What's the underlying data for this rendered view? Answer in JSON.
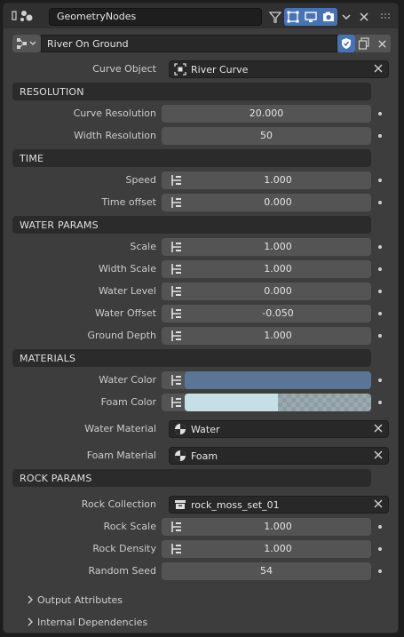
{
  "header": {
    "modifier_name": "GeometryNodes",
    "icons": [
      "wrench-icon",
      "show-in-editmode-icon",
      "show-on-cage-icon",
      "realtime-display-icon",
      "render-icon",
      "chevron-down-icon",
      "close-icon",
      "drag-grip-icon"
    ]
  },
  "node_group": {
    "name": "River On Ground",
    "icons": [
      "node-tree-icon",
      "fake-user-shield-icon",
      "duplicate-icon",
      "close-icon"
    ]
  },
  "curve_object": {
    "label": "Curve Object",
    "value": "River Curve"
  },
  "sections": {
    "resolution": "RESOLUTION",
    "time": "TIME",
    "water_params": "WATER PARAMS",
    "materials": "MATERIALS",
    "rock_params": "ROCK PARAMS"
  },
  "resolution": {
    "curve_resolution": {
      "label": "Curve Resolution",
      "value": "20.000"
    },
    "width_resolution": {
      "label": "Width Resolution",
      "value": "50"
    }
  },
  "time": {
    "speed": {
      "label": "Speed",
      "value": "1.000"
    },
    "time_offset": {
      "label": "Time offset",
      "value": "0.000"
    }
  },
  "water": {
    "scale": {
      "label": "Scale",
      "value": "1.000"
    },
    "width_scale": {
      "label": "Width Scale",
      "value": "1.000"
    },
    "water_level": {
      "label": "Water Level",
      "value": "0.000"
    },
    "water_offset": {
      "label": "Water Offset",
      "value": "-0.050"
    },
    "ground_depth": {
      "label": "Ground Depth",
      "value": "1.000"
    }
  },
  "materials": {
    "water_color": {
      "label": "Water Color",
      "color": "#5a7596"
    },
    "foam_color": {
      "label": "Foam Color",
      "color": "#c6dfe6",
      "alpha": 0.5
    },
    "water_material": {
      "label": "Water Material",
      "value": "Water"
    },
    "foam_material": {
      "label": "Foam Material",
      "value": "Foam"
    }
  },
  "rock": {
    "rock_collection": {
      "label": "Rock Collection",
      "value": "rock_moss_set_01"
    },
    "rock_scale": {
      "label": "Rock Scale",
      "value": "1.000"
    },
    "rock_density": {
      "label": "Rock Density",
      "value": "1.000"
    },
    "random_seed": {
      "label": "Random Seed",
      "value": "54"
    }
  },
  "folds": {
    "output_attributes": "Output Attributes",
    "internal_dependencies": "Internal Dependencies"
  },
  "colors": {
    "panel_bg": "#3d3d3d",
    "field_bg": "#545454",
    "section_bg": "#2b2b2b",
    "accent_blue": "#4772b3"
  }
}
